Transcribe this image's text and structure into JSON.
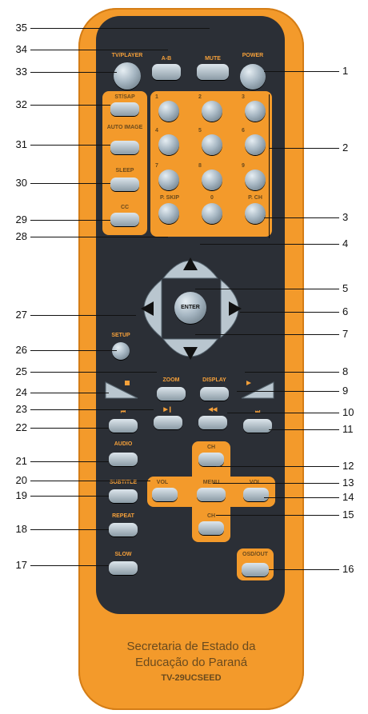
{
  "buttons": {
    "tv_player": "TV/PLAYER",
    "ab": "A-B",
    "mute": "MUTE",
    "power": "POWER",
    "st_sap": "ST/SAP",
    "auto_image": "AUTO IMAGE",
    "sleep": "SLEEP",
    "cc": "CC",
    "digits": [
      "1",
      "2",
      "3",
      "4",
      "5",
      "6",
      "7",
      "8",
      "9"
    ],
    "p_skip": "P. SKIP",
    "zero": "0",
    "p_ch": "P. CH",
    "enter": "ENTER",
    "setup": "SETUP",
    "zoom": "ZOOM",
    "display": "DISPLAY",
    "audio": "AUDIO",
    "subtitle": "SUBTITLE",
    "menu": "MENU",
    "ch_up": "CH",
    "ch_down": "CH",
    "vol_left": "VOL",
    "vol_right": "VOL",
    "repeat": "REPEAT",
    "slow": "SLOW",
    "osd_out": "OSD/OUT"
  },
  "callouts_left": [
    "35",
    "34",
    "33",
    "32",
    "31",
    "30",
    "29",
    "28",
    "27",
    "26",
    "25",
    "24",
    "23",
    "22",
    "21",
    "20",
    "19",
    "18",
    "17"
  ],
  "callouts_right": [
    "1",
    "2",
    "3",
    "4",
    "5",
    "6",
    "7",
    "8",
    "9",
    "10",
    "11",
    "12",
    "13",
    "14",
    "15",
    "16"
  ],
  "footer": {
    "line1": "Secretaria de Estado da",
    "line2": "Educação do Paraná",
    "model": "TV-29UCSEED"
  },
  "colors": {
    "body": "#f39a2b",
    "face": "#2b2f36",
    "button": "#a7b7c3"
  }
}
